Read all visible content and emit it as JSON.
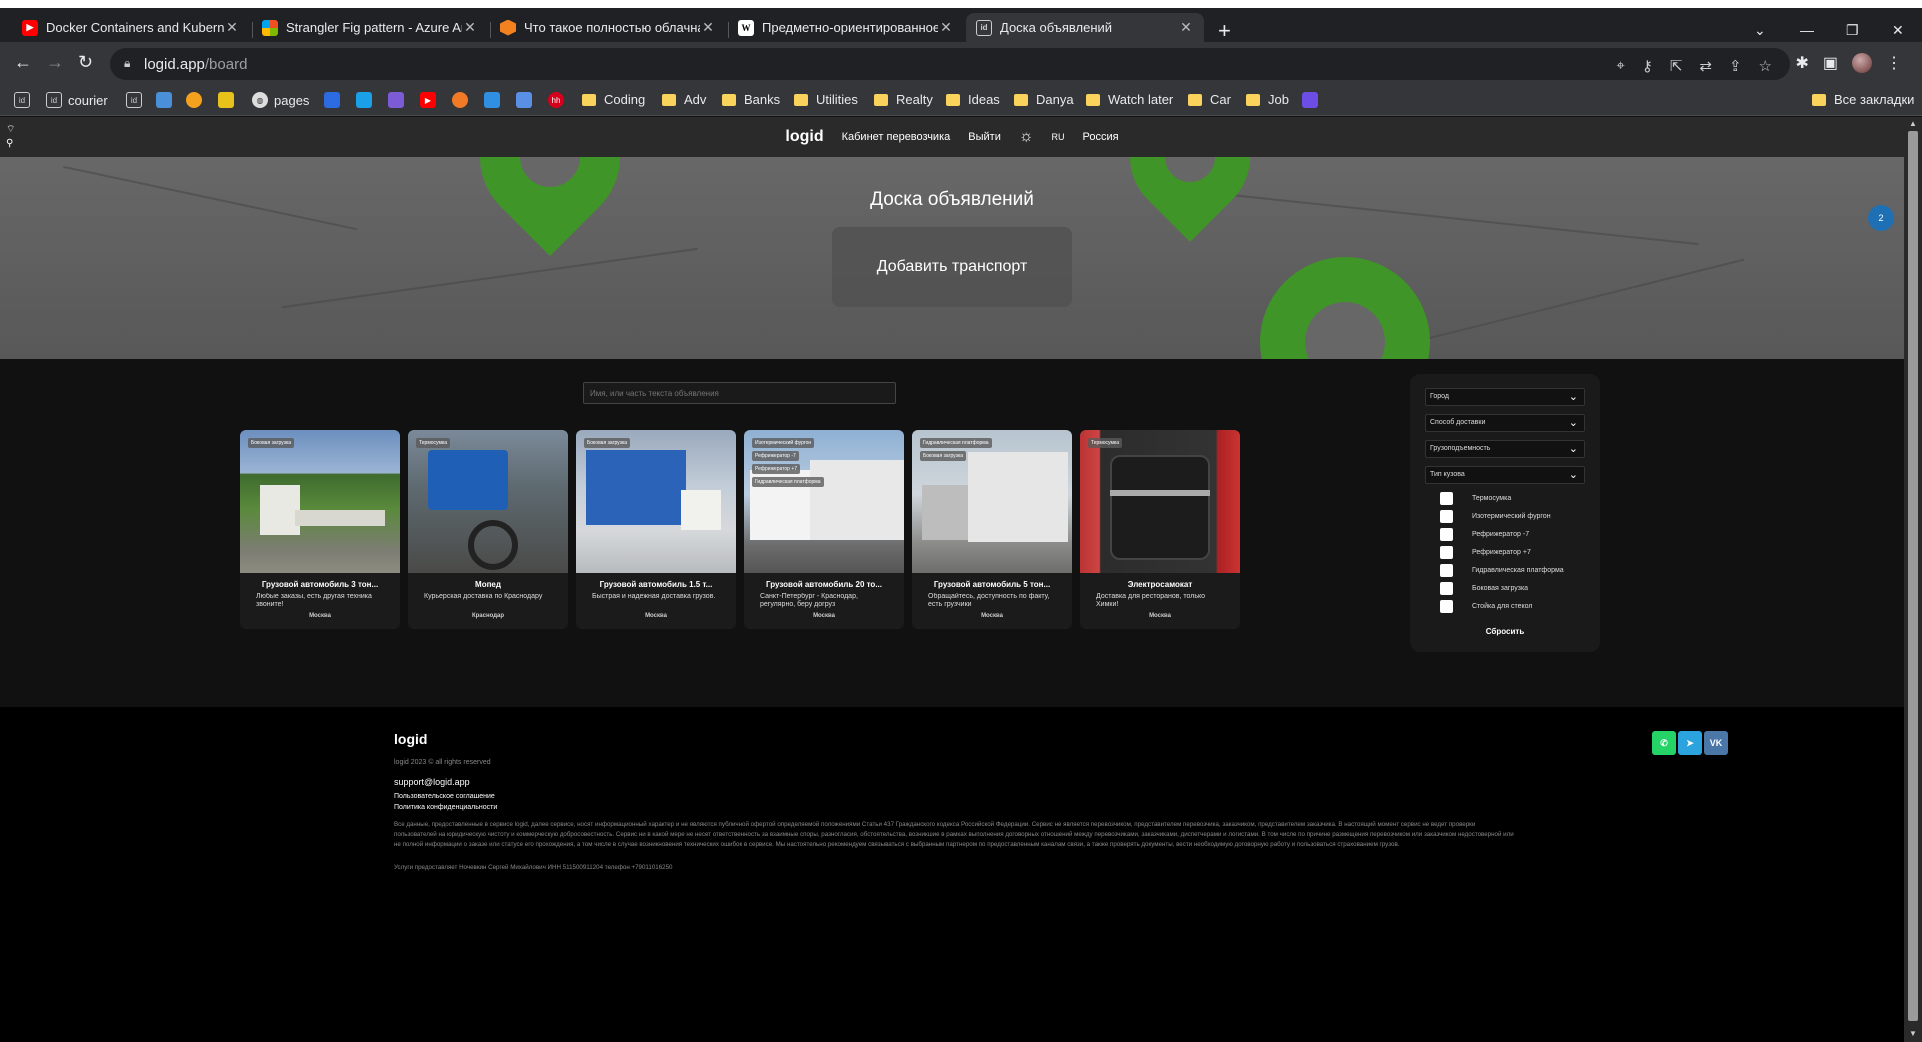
{
  "browser": {
    "tabs": [
      {
        "title": "Docker Containers and Kuberne",
        "icon": "youtube-icon"
      },
      {
        "title": "Strangler Fig pattern - Azure Arc",
        "icon": "microsoft-icon"
      },
      {
        "title": "Что такое полностью облачна",
        "icon": "hexagon-icon"
      },
      {
        "title": "Предметно-ориентированное",
        "icon": "wikipedia-icon"
      },
      {
        "title": "Доска объявлений",
        "icon": "logid-icon"
      }
    ],
    "url_host": "logid.app",
    "url_path": "/board",
    "bookmarks": [
      {
        "label": "courier",
        "type": "site"
      },
      {
        "label": "pages",
        "type": "site"
      },
      {
        "label": "Coding",
        "type": "folder"
      },
      {
        "label": "Adv",
        "type": "folder"
      },
      {
        "label": "Banks",
        "type": "folder"
      },
      {
        "label": "Utilities",
        "type": "folder"
      },
      {
        "label": "Realty",
        "type": "folder"
      },
      {
        "label": "Ideas",
        "type": "folder"
      },
      {
        "label": "Danya",
        "type": "folder"
      },
      {
        "label": "Watch later",
        "type": "folder"
      },
      {
        "label": "Car",
        "type": "folder"
      },
      {
        "label": "Job",
        "type": "folder"
      }
    ],
    "all_bookmarks": "Все закладки"
  },
  "header": {
    "logo": "logid",
    "cabinet": "Кабинет перевозчика",
    "logout": "Выйти",
    "lang": "RU",
    "country": "Россия"
  },
  "hero": {
    "title": "Доска объявлений",
    "add_button": "Добавить транспорт",
    "badge": "2"
  },
  "search": {
    "placeholder": "Имя, или часть текста объявления"
  },
  "cards": [
    {
      "title": "Грузовой автомобиль 3 тон...",
      "desc": "Любые заказы, есть другая техника звоните!",
      "city": "Москва",
      "tags": [
        "Боковая загрузка"
      ]
    },
    {
      "title": "Мопед",
      "desc": "Курьерская доставка по Краснодару",
      "city": "Краснодар",
      "tags": [
        "Термосумка"
      ]
    },
    {
      "title": "Грузовой автомобиль 1.5 т...",
      "desc": "Быстрая и надежная доставка грузов.",
      "city": "Москва",
      "tags": [
        "Боковая загрузка"
      ]
    },
    {
      "title": "Грузовой автомобиль 20 то...",
      "desc": "Санкт-Петербург - Краснодар, регулярно, беру догруз",
      "city": "Москва",
      "tags": [
        "Изотермический фургон",
        "Рефрижератор -7",
        "Рефрижератор +7",
        "Гидравлическая платформа"
      ]
    },
    {
      "title": "Грузовой автомобиль 5 тон...",
      "desc": "Обращайтесь, доступность по факту, есть грузчики",
      "city": "Москва",
      "tags": [
        "Гидравлическая платформа",
        "Боковая загрузка"
      ]
    },
    {
      "title": "Электросамокат",
      "desc": "Доставка для ресторанов, только Химки!",
      "city": "Москва",
      "tags": [
        "Термосумка"
      ]
    }
  ],
  "filters": {
    "city": "Город",
    "delivery": "Способ доставки",
    "capacity": "Грузоподъемность",
    "body_type": "Тип кузова",
    "options": [
      "Термосумка",
      "Изотермический фургон",
      "Рефрижератор -7",
      "Рефрижератор +7",
      "Гидравлическая платформа",
      "Боковая загрузка",
      "Стойка для стекол"
    ],
    "reset": "Сбросить"
  },
  "footer": {
    "logo": "logid",
    "copyright": "logid 2023 © all rights reserved",
    "email": "support@logid.app",
    "terms": "Пользовательское соглашение",
    "privacy": "Политика конфиденциальности",
    "disclaimer": "Все данные, предоставленные в сервисе logid, далее сервисе, носят информационный характер и не являются публичной офертой определяемой положениями Статьи 437 Гражданского кодекса Российской Федерации. Сервис не является перевозчиком, представителем перевозчика, заказчиком, представителем заказчика. В настоящий момент сервис не ведет проверки пользователей на юридическую чистоту и коммерческую добросовестность. Сервис ни в какой мере не несет ответственность за взаимные споры, разногласия, обстоятельства, возникшие в рамках выполнения договорных отношений между перевозчиками, заказчиками, диспетчерами и логистами. В том числе по причине размещения перевозчиком или заказчиком недостоверной или не полной информации о заказе или статусе его прохождения, а том числе в случае возникновения технических ошибок в сервисе. Мы настоятельно рекомендуем связываться с выбранным партнером по предоставленным каналам связи, а также проверять документы, вести необходимую договорную работу и пользоваться страхованием грузов.",
    "provider": "Услуги предоставляет Ночевкин Сергей Михайлович ИНН 511500911204 телефон +79011016250",
    "socials": [
      "whatsapp-icon",
      "telegram-icon",
      "vk-icon"
    ],
    "vk_label": "VK"
  }
}
